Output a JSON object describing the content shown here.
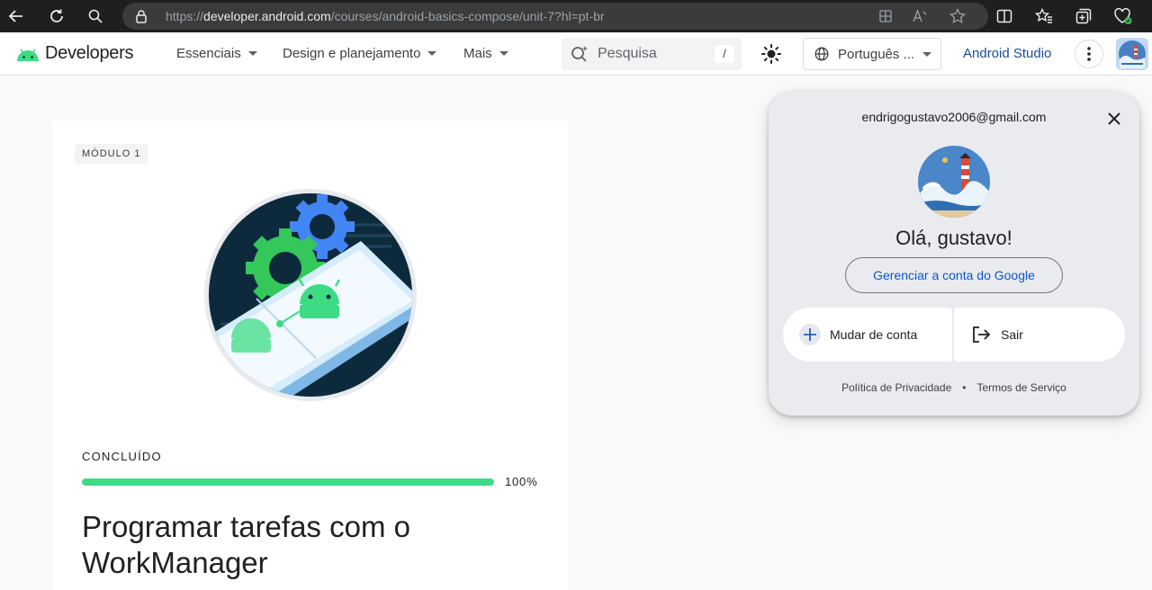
{
  "browser": {
    "url_prefix": "https://",
    "url_domain": "developer.android.com",
    "url_path": "/courses/android-basics-compose/unit-7?hl=pt-br"
  },
  "header": {
    "logo_text": "Developers",
    "nav": [
      "Essenciais",
      "Design e planejamento",
      "Mais"
    ],
    "search_placeholder": "Pesquisa",
    "search_shortcut": "/",
    "language": "Português ...",
    "studio_link": "Android Studio"
  },
  "card": {
    "badge": "MÓDULO 1",
    "status": "CONCLUÍDO",
    "progress_percent": 100,
    "progress_label": "100%",
    "title": "Programar tarefas com o WorkManager"
  },
  "account": {
    "email": "endrigogustavo2006@gmail.com",
    "greeting": "Olá, gustavo!",
    "manage_label": "Gerenciar a conta do Google",
    "switch_label": "Mudar de conta",
    "signout_label": "Sair",
    "privacy_label": "Política de Privacidade",
    "separator": "•",
    "terms_label": "Termos de Serviço"
  },
  "colors": {
    "android_green": "#3ddc84",
    "link_blue": "#0b57d0",
    "browser_bar": "#1f1f1f"
  }
}
